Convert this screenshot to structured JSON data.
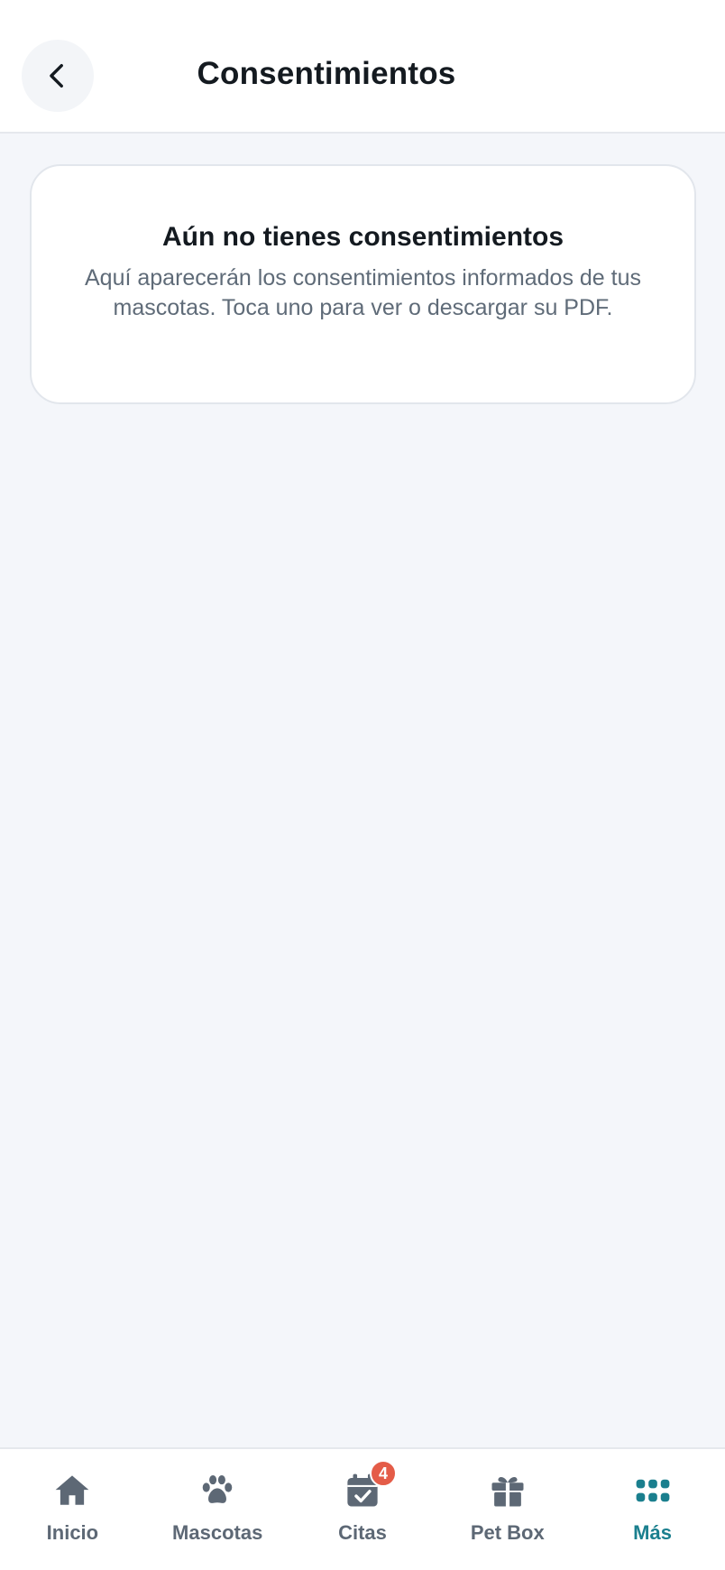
{
  "header": {
    "title": "Consentimientos",
    "back_icon": "chevron-left-icon"
  },
  "empty_state": {
    "title": "Aún no tienes consentimientos",
    "description": "Aquí aparecerán los consentimientos informados de tus mascotas. Toca uno para ver o descargar su PDF."
  },
  "bottom_nav": {
    "items": [
      {
        "label": "Inicio",
        "icon": "home-icon"
      },
      {
        "label": "Mascotas",
        "icon": "paw-icon"
      },
      {
        "label": "Citas",
        "icon": "calendar-check-icon",
        "badge": "4"
      },
      {
        "label": "Pet Box",
        "icon": "gift-icon"
      },
      {
        "label": "Más",
        "icon": "grid-dots-icon",
        "active": true
      }
    ]
  },
  "colors": {
    "accent": "#1a7f8e",
    "badge": "#e45c48",
    "icon_inactive": "#5d6875",
    "background": "#f4f6fa"
  }
}
